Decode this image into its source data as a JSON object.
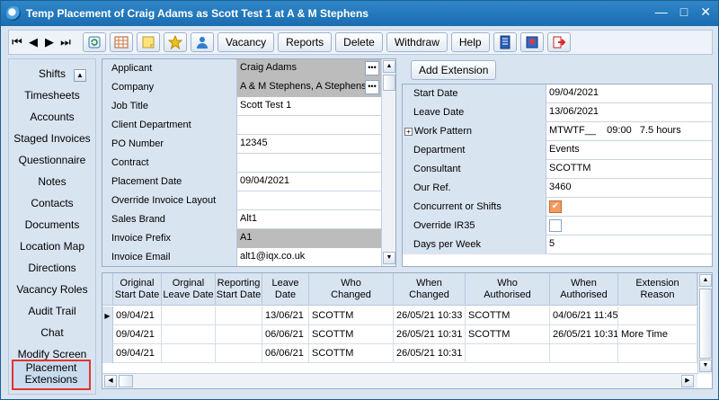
{
  "window": {
    "title": "Temp Placement of Craig Adams as Scott Test 1 at A & M Stephens",
    "minimize": "—",
    "maximize": "□",
    "close": "✕"
  },
  "toolbar": {
    "nav": [
      "⏮",
      "◀",
      "▶",
      "⏭"
    ],
    "buttons": {
      "vacancy": "Vacancy",
      "reports": "Reports",
      "delete": "Delete",
      "withdraw": "Withdraw",
      "help": "Help"
    }
  },
  "sidebar": {
    "items": [
      "Shifts",
      "Timesheets",
      "Accounts",
      "Staged Invoices",
      "Questionnaire",
      "Notes",
      "Contacts",
      "Documents",
      "Location Map",
      "Directions",
      "Vacancy Roles",
      "Audit Trail",
      "Chat",
      "Modify Screen"
    ],
    "active_line1": "Placement",
    "active_line2": "Extensions",
    "collapse": "▲"
  },
  "fields": {
    "rows": [
      {
        "label": "Applicant",
        "value": "Craig Adams"
      },
      {
        "label": "Company",
        "value": "A & M Stephens, A Stephens"
      },
      {
        "label": "Job Title",
        "value": "Scott Test 1"
      },
      {
        "label": "Client Department",
        "value": ""
      },
      {
        "label": "PO Number",
        "value": "12345"
      },
      {
        "label": "Contract",
        "value": ""
      },
      {
        "label": "Placement Date",
        "value": "09/04/2021"
      },
      {
        "label": "Override Invoice Layout",
        "value": ""
      },
      {
        "label": "Sales Brand",
        "value": "Alt1"
      },
      {
        "label": "Invoice Prefix",
        "value": "A1"
      },
      {
        "label": "Invoice Email",
        "value": "alt1@iqx.co.uk"
      }
    ],
    "ellipsis": "•••"
  },
  "right": {
    "add_extension": "Add Extension",
    "rows": [
      {
        "label": "Start Date",
        "value": "09/04/2021"
      },
      {
        "label": "Leave Date",
        "value": "13/06/2021"
      },
      {
        "label": "Work Pattern",
        "value": "MTWTF__    09:00   7.5 hours"
      },
      {
        "label": "Department",
        "value": "Events"
      },
      {
        "label": "Consultant",
        "value": "SCOTTM"
      },
      {
        "label": "Our Ref.",
        "value": "3460"
      },
      {
        "label": "Concurrent or Shifts",
        "value": ""
      },
      {
        "label": "Override IR35",
        "value": ""
      },
      {
        "label": "Days per Week",
        "value": "5"
      }
    ],
    "expand": "+",
    "check": "✔"
  },
  "table": {
    "headers": [
      [
        "Original",
        "Start Date"
      ],
      [
        "Orginal",
        "Leave Date"
      ],
      [
        "Reporting",
        "Start Date"
      ],
      [
        "Leave",
        "Date"
      ],
      [
        "Who",
        "Changed"
      ],
      [
        "When",
        "Changed"
      ],
      [
        "Who",
        "Authorised"
      ],
      [
        "When",
        "Authorised"
      ],
      [
        "Extension",
        "Reason"
      ]
    ],
    "rows": [
      [
        "09/04/21",
        "",
        "",
        "13/06/21",
        "SCOTTM",
        "26/05/21 10:33",
        "SCOTTM",
        "04/06/21 11:45",
        ""
      ],
      [
        "09/04/21",
        "",
        "",
        "06/06/21",
        "SCOTTM",
        "26/05/21 10:31",
        "SCOTTM",
        "26/05/21 10:31",
        "More Time"
      ],
      [
        "09/04/21",
        "",
        "",
        "06/06/21",
        "SCOTTM",
        "26/05/21 10:31",
        "",
        "",
        ""
      ]
    ],
    "row_pointer": "▶"
  }
}
